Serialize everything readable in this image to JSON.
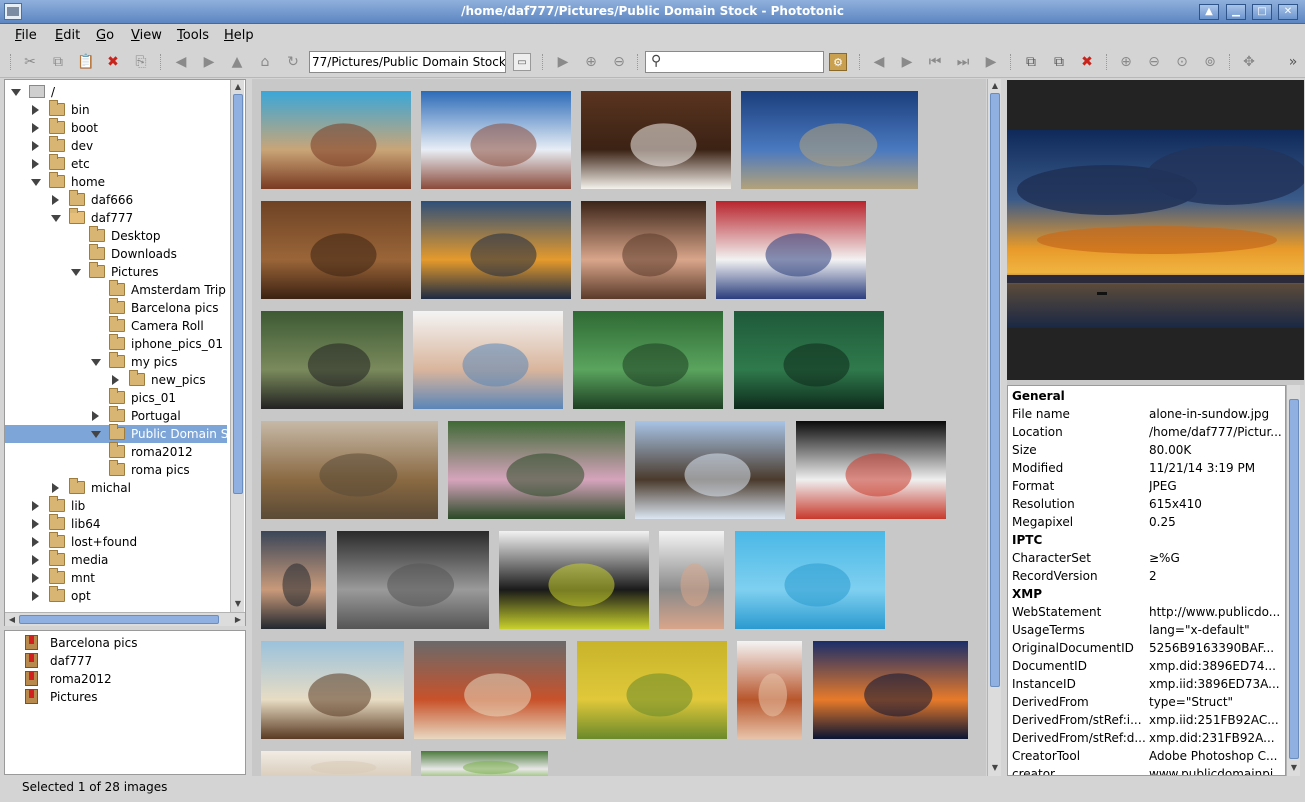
{
  "window": {
    "title": "/home/daf777/Pictures/Public Domain Stock - Phototonic"
  },
  "menu": [
    "File",
    "Edit",
    "Go",
    "View",
    "Tools",
    "Help"
  ],
  "menu_mnemonics": [
    "F",
    "E",
    "G",
    "V",
    "T",
    "H"
  ],
  "toolbar": {
    "path_value": "77/Pictures/Public Domain Stock",
    "search_placeholder": ""
  },
  "tree": [
    {
      "label": "/",
      "depth": 0,
      "state": "open",
      "icon": "drive"
    },
    {
      "label": "bin",
      "depth": 1,
      "state": "closed",
      "icon": "folder"
    },
    {
      "label": "boot",
      "depth": 1,
      "state": "closed",
      "icon": "folder"
    },
    {
      "label": "dev",
      "depth": 1,
      "state": "closed",
      "icon": "folder"
    },
    {
      "label": "etc",
      "depth": 1,
      "state": "closed",
      "icon": "folder"
    },
    {
      "label": "home",
      "depth": 1,
      "state": "open",
      "icon": "folder"
    },
    {
      "label": "daf666",
      "depth": 2,
      "state": "closed",
      "icon": "folder"
    },
    {
      "label": "daf777",
      "depth": 2,
      "state": "open",
      "icon": "home-folder"
    },
    {
      "label": "Desktop",
      "depth": 3,
      "state": "none",
      "icon": "folder"
    },
    {
      "label": "Downloads",
      "depth": 3,
      "state": "none",
      "icon": "folder"
    },
    {
      "label": "Pictures",
      "depth": 3,
      "state": "open",
      "icon": "folder"
    },
    {
      "label": "Amsterdam Trip",
      "depth": 4,
      "state": "none",
      "icon": "folder"
    },
    {
      "label": "Barcelona pics",
      "depth": 4,
      "state": "none",
      "icon": "folder"
    },
    {
      "label": "Camera Roll",
      "depth": 4,
      "state": "none",
      "icon": "folder"
    },
    {
      "label": "iphone_pics_01",
      "depth": 4,
      "state": "none",
      "icon": "folder"
    },
    {
      "label": "my pics",
      "depth": 4,
      "state": "open",
      "icon": "folder"
    },
    {
      "label": "new_pics",
      "depth": 5,
      "state": "closed",
      "icon": "folder"
    },
    {
      "label": "pics_01",
      "depth": 4,
      "state": "none",
      "icon": "folder"
    },
    {
      "label": "Portugal",
      "depth": 4,
      "state": "closed",
      "icon": "folder"
    },
    {
      "label": "Public Domain S",
      "depth": 4,
      "state": "open",
      "icon": "folder",
      "selected": true
    },
    {
      "label": "roma2012",
      "depth": 4,
      "state": "none",
      "icon": "folder"
    },
    {
      "label": "roma pics",
      "depth": 4,
      "state": "none",
      "icon": "folder"
    },
    {
      "label": "michal",
      "depth": 2,
      "state": "closed",
      "icon": "folder"
    },
    {
      "label": "lib",
      "depth": 1,
      "state": "closed",
      "icon": "folder"
    },
    {
      "label": "lib64",
      "depth": 1,
      "state": "closed",
      "icon": "folder"
    },
    {
      "label": "lost+found",
      "depth": 1,
      "state": "closed",
      "icon": "folder"
    },
    {
      "label": "media",
      "depth": 1,
      "state": "closed",
      "icon": "folder"
    },
    {
      "label": "mnt",
      "depth": 1,
      "state": "closed",
      "icon": "folder"
    },
    {
      "label": "opt",
      "depth": 1,
      "state": "closed",
      "icon": "folder"
    }
  ],
  "bookmarks": [
    "Barcelona pics",
    "daf777",
    "roma2012",
    "Pictures"
  ],
  "thumbnails": [
    {
      "name": "bench-beach",
      "colors": [
        "#3aa7d8",
        "#c9a577",
        "#7a3a22"
      ]
    },
    {
      "name": "snowy-village",
      "colors": [
        "#2c6bb8",
        "#e8eef5",
        "#8a4a3a"
      ]
    },
    {
      "name": "coffee-cup",
      "colors": [
        "#5a3420",
        "#3b2214",
        "#f4f1ec"
      ]
    },
    {
      "name": "wind-turbines",
      "colors": [
        "#1b3e7c",
        "#4a79c0",
        "#b3a27a"
      ]
    },
    {
      "name": "coffee-beans",
      "colors": [
        "#6e4325",
        "#9a6538",
        "#3c2212"
      ]
    },
    {
      "name": "sunset-clouds",
      "colors": [
        "#2e4f7a",
        "#e59a2c",
        "#1c2a44"
      ]
    },
    {
      "name": "woman-portrait",
      "colors": [
        "#3b2418",
        "#d9a58a",
        "#5a3a2a"
      ]
    },
    {
      "name": "american-flag",
      "colors": [
        "#b8242c",
        "#f2f2f2",
        "#2a3d7c"
      ]
    },
    {
      "name": "photo-collage",
      "colors": [
        "#3d5a34",
        "#7a8a5c",
        "#222"
      ]
    },
    {
      "name": "family-photo",
      "colors": [
        "#f4f4f4",
        "#d9b59c",
        "#5a86b8"
      ]
    },
    {
      "name": "green-leaves",
      "colors": [
        "#2e6a34",
        "#5aa45e",
        "#1d3e22"
      ]
    },
    {
      "name": "green-car",
      "colors": [
        "#1f5a3a",
        "#2f7a4c",
        "#0e2a1c"
      ]
    },
    {
      "name": "parliament",
      "colors": [
        "#c7b9a8",
        "#8a6a42",
        "#5a4a36"
      ]
    },
    {
      "name": "pink-flowers",
      "colors": [
        "#3f6a36",
        "#d6a4bc",
        "#2a4a26"
      ]
    },
    {
      "name": "pelican",
      "colors": [
        "#a8c4e6",
        "#4a3a2c",
        "#dbe6f2"
      ]
    },
    {
      "name": "scientists",
      "colors": [
        "#0a0a0a",
        "#efefef",
        "#c83a2c"
      ]
    },
    {
      "name": "man-shrugging",
      "colors": [
        "#3a4658",
        "#c99a7a",
        "#22282f"
      ]
    },
    {
      "name": "metal-spiral",
      "colors": [
        "#2a2a2a",
        "#9a9a9a",
        "#555"
      ]
    },
    {
      "name": "skateboard-wheels",
      "colors": [
        "#f2f2f2",
        "#1a1a1a",
        "#c8d02c"
      ]
    },
    {
      "name": "woman-dress",
      "colors": [
        "#f4f4f4",
        "#8a8a8a",
        "#d9a58a"
      ]
    },
    {
      "name": "water-surface",
      "colors": [
        "#4ab8e6",
        "#7fd0f0",
        "#2a9ad0"
      ]
    },
    {
      "name": "wooden-boat",
      "colors": [
        "#9ac2dc",
        "#e8dcc4",
        "#5a3a22"
      ]
    },
    {
      "name": "tree-barrel",
      "colors": [
        "#6a6a6a",
        "#c8522a",
        "#e8d8c0"
      ]
    },
    {
      "name": "rice-terraces",
      "colors": [
        "#c8b42a",
        "#e0c83a",
        "#6a8a2a"
      ]
    },
    {
      "name": "redhead-woman",
      "colors": [
        "#f4f4f4",
        "#b8562c",
        "#e8c4aa"
      ]
    },
    {
      "name": "fisherman-sunset",
      "colors": [
        "#1a2e6a",
        "#e87a2a",
        "#0a1434"
      ]
    },
    {
      "name": "partial-1",
      "colors": [
        "#f2ece4",
        "#e0d6c8",
        "#d8cab6"
      ]
    },
    {
      "name": "partial-2",
      "colors": [
        "#4a7a3a",
        "#e8e8e8",
        "#7ab04a"
      ]
    }
  ],
  "preview": {
    "name": "alone-in-sundow",
    "colors": [
      "#0a1a3a",
      "#e8902a",
      "#1c3058"
    ]
  },
  "info": [
    {
      "type": "header",
      "label": "General"
    },
    {
      "label": "File name",
      "value": "alone-in-sundow.jpg"
    },
    {
      "label": "Location",
      "value": "/home/daf777/Pictur..."
    },
    {
      "label": "Size",
      "value": "80.00K"
    },
    {
      "label": "Modified",
      "value": "11/21/14 3:19 PM"
    },
    {
      "label": "Format",
      "value": "JPEG"
    },
    {
      "label": "Resolution",
      "value": "615x410"
    },
    {
      "label": "Megapixel",
      "value": "0.25"
    },
    {
      "type": "header",
      "label": "IPTC"
    },
    {
      "label": "CharacterSet",
      "value": "≥%G"
    },
    {
      "label": "RecordVersion",
      "value": "2"
    },
    {
      "type": "header",
      "label": "XMP"
    },
    {
      "label": "WebStatement",
      "value": "http://www.publicdo..."
    },
    {
      "label": "UsageTerms",
      "value": "lang=\"x-default\""
    },
    {
      "label": "OriginalDocumentID",
      "value": "5256B9163390BAF..."
    },
    {
      "label": "DocumentID",
      "value": "xmp.did:3896ED74..."
    },
    {
      "label": "InstanceID",
      "value": "xmp.iid:3896ED73A..."
    },
    {
      "label": "DerivedFrom",
      "value": "type=\"Struct\""
    },
    {
      "label": "DerivedFrom/stRef:i...",
      "value": "xmp.iid:251FB92AC..."
    },
    {
      "label": "DerivedFrom/stRef:d...",
      "value": "xmp.did:231FB92A..."
    },
    {
      "label": "CreatorTool",
      "value": "Adobe Photoshop C..."
    },
    {
      "label": "creator",
      "value": "www.publicdomainpi..."
    }
  ],
  "status": {
    "text": "Selected 1 of 28 images"
  },
  "icons": {
    "cut": "✂",
    "copy": "⧉",
    "paste": "📋",
    "delete": "✖",
    "save": "⎘",
    "back": "◀",
    "forward": "▶",
    "up": "▲",
    "home": "⌂",
    "refresh": "↻",
    "slideshow": "▶",
    "zoom-in": "⊕",
    "zoom-out": "⊖",
    "search": "⚲",
    "filter": "⚙",
    "prev": "◀",
    "next": "▶",
    "first": "⏮",
    "last": "⏭",
    "play": "▶",
    "copy-to": "⧉",
    "move-to": "⧉",
    "remove": "✖",
    "zoom": "⊕",
    "reset-zoom": "⊖",
    "fit": "⊙",
    "orig": "⊚",
    "rotate": "✥",
    "more": "»"
  }
}
